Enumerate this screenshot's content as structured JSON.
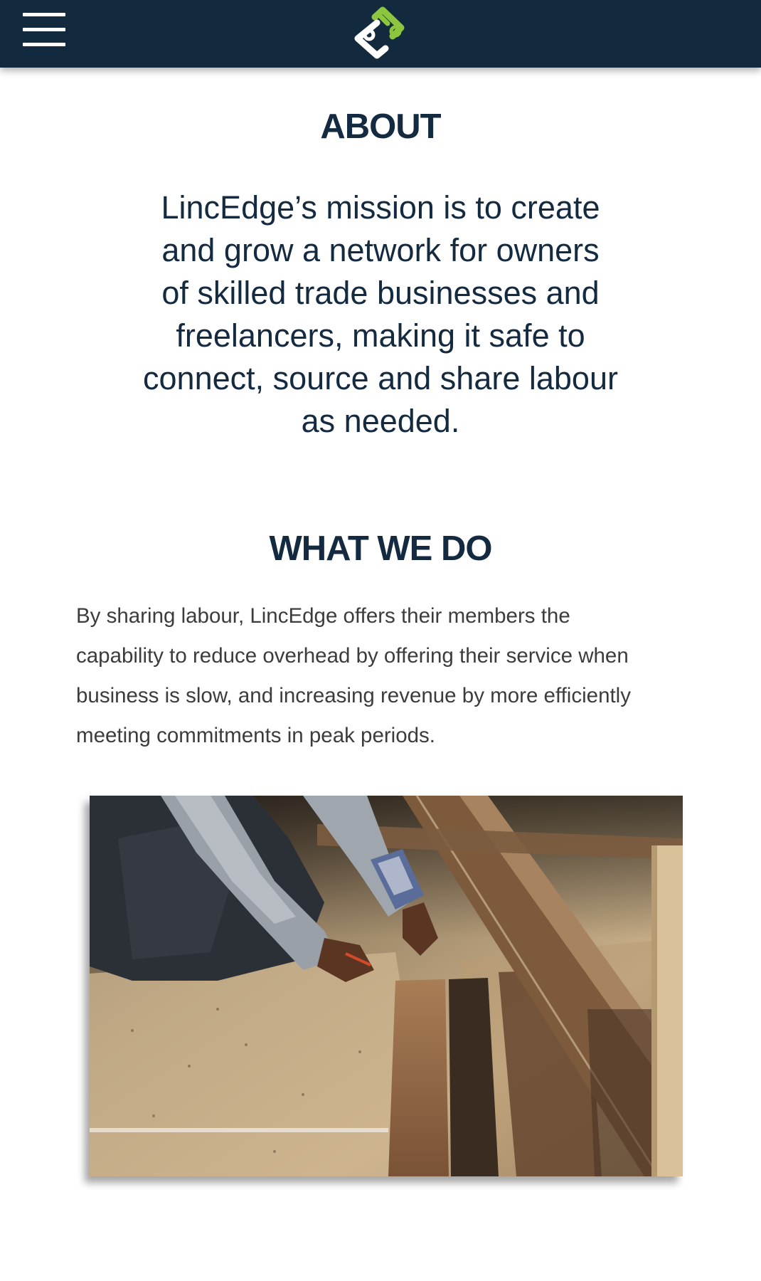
{
  "header": {
    "menu_icon": "hamburger-menu-icon",
    "logo_icon": "lincedge-logo-icon",
    "bg_color": "#13293d",
    "logo_colors": [
      "#8cc63f",
      "#ffffff"
    ]
  },
  "about": {
    "title": "ABOUT",
    "mission_lines": [
      "LincEdge’s mission is to create",
      "and grow a network for owners",
      "of skilled trade businesses and",
      "freelancers, making it safe to",
      "connect, source and share labour",
      "as needed."
    ]
  },
  "what_we_do": {
    "title": "WHAT WE DO",
    "body_lines": [
      "By sharing labour, LincEdge offers their members the",
      "capability to reduce overhead by offering their service when",
      "business is slow, and increasing revenue by more efficiently",
      "meeting commitments in peak periods."
    ]
  },
  "photo": {
    "subject": "tradesperson-measuring-lumber-photo"
  },
  "colors": {
    "heading": "#142a40",
    "body_text": "#3c3c3c"
  }
}
